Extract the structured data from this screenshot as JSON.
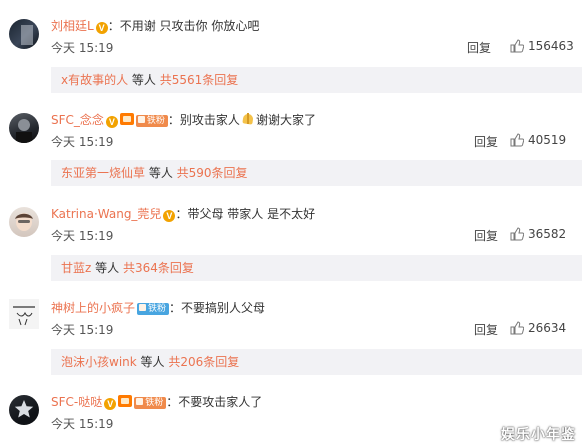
{
  "comments": [
    {
      "user": "刘相廷L",
      "text": "：不用谢 只攻击你 你放心吧",
      "time": "今天 15:19",
      "reply": "回复",
      "likes": "156463",
      "sub": {
        "name": "x有故事的人",
        "etc": " 等人 ",
        "more": "共5561条回复"
      }
    },
    {
      "user": "SFC_念念",
      "fan": "铁粉",
      "text": "：别攻击家人",
      "text2": "谢谢大家了",
      "time": "今天 15:19",
      "reply": "回复",
      "likes": "40519",
      "sub": {
        "name": "东亚第一烧仙草",
        "etc": " 等人 ",
        "more": "共590条回复"
      }
    },
    {
      "user": "Katrina·Wang_莞兒",
      "text": "：带父母 带家人 是不太好",
      "time": "今天 15:19",
      "reply": "回复",
      "likes": "36582",
      "sub": {
        "name": "甘蓝z",
        "etc": " 等人 ",
        "more": "共364条回复"
      }
    },
    {
      "user": "神树上的小疯子",
      "fan": "铁粉",
      "text": "：不要搞别人父母",
      "time": "今天 15:19",
      "reply": "回复",
      "likes": "26634",
      "sub": {
        "name": "泡沫小孩wink",
        "etc": " 等人 ",
        "more": "共206条回复"
      }
    },
    {
      "user": "SFC-哒哒",
      "fan": "铁粉",
      "text": "：不要攻击家人了",
      "time": "今天 15:19"
    }
  ],
  "watermark": "娱乐小年鉴",
  "colors": {
    "username": "#eb7350",
    "sub_bg": "#f2f2f5",
    "text": "#333333"
  }
}
